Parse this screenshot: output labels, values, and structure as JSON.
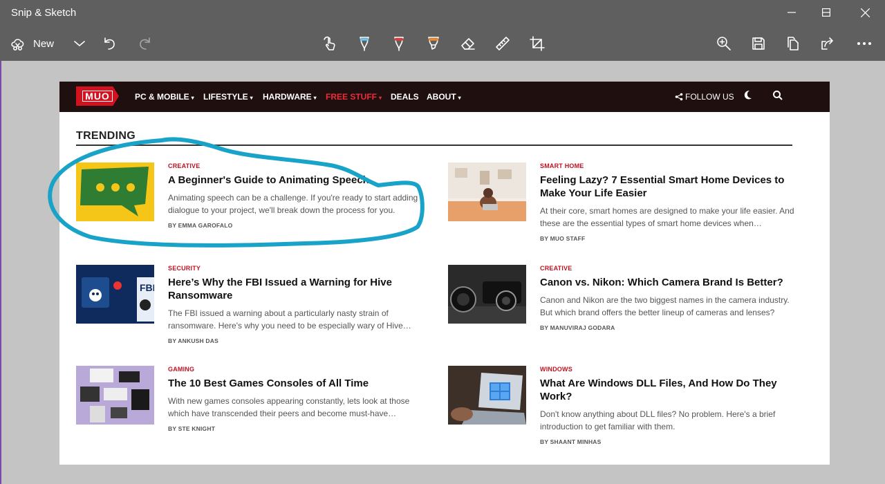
{
  "window": {
    "title": "Snip & Sketch"
  },
  "toolbar": {
    "new_label": "New"
  },
  "accent_colors": {
    "pen_underline": "#b58be0",
    "annotation_stroke": "#1aa3c8",
    "site_red": "#c0111f"
  },
  "site": {
    "logo_text": "MUO",
    "nav": [
      {
        "label": "PC & MOBILE",
        "caret": "▾"
      },
      {
        "label": "LIFESTYLE",
        "caret": "▾"
      },
      {
        "label": "HARDWARE",
        "caret": "▾"
      },
      {
        "label": "FREE STUFF",
        "caret": "▾"
      },
      {
        "label": "DEALS",
        "caret": ""
      },
      {
        "label": "ABOUT",
        "caret": "▾"
      }
    ],
    "follow_label": "FOLLOW US",
    "trending_heading": "TRENDING",
    "articles": [
      {
        "category": "CREATIVE",
        "title": "A Beginner's Guide to Animating Speech",
        "description": "Animating speech can be a challenge. If you're ready to start adding dialogue to your project, we'll break down the process for you.",
        "byline": "BY EMMA GAROFALO"
      },
      {
        "category": "SMART HOME",
        "title": "Feeling Lazy? 7 Essential Smart Home Devices to Make Your Life Easier",
        "description": "At their core, smart homes are designed to make your life easier. And these are the essential types of smart home devices when…",
        "byline": "BY MUO STAFF"
      },
      {
        "category": "SECURITY",
        "title": "Here’s Why the FBI Issued a Warning for Hive Ransomware",
        "description": "The FBI issued a warning about a particularly nasty strain of ransomware. Here's why you need to be especially wary of Hive…",
        "byline": "BY ANKUSH DAS"
      },
      {
        "category": "CREATIVE",
        "title": "Canon vs. Nikon: Which Camera Brand Is Better?",
        "description": "Canon and Nikon are the two biggest names in the camera industry. But which brand offers the better lineup of cameras and lenses?",
        "byline": "BY MANUVIRAJ GODARA"
      },
      {
        "category": "GAMING",
        "title": "The 10 Best Games Consoles of All Time",
        "description": "With new games consoles appearing constantly, lets look at those which have transcended their peers and become must-have…",
        "byline": "BY STE KNIGHT"
      },
      {
        "category": "WINDOWS",
        "title": "What Are Windows DLL Files, And How Do They Work?",
        "description": "Don't know anything about DLL files? No problem. Here's a brief introduction to get familiar with them.",
        "byline": "BY SHAANT MINHAS"
      }
    ]
  }
}
